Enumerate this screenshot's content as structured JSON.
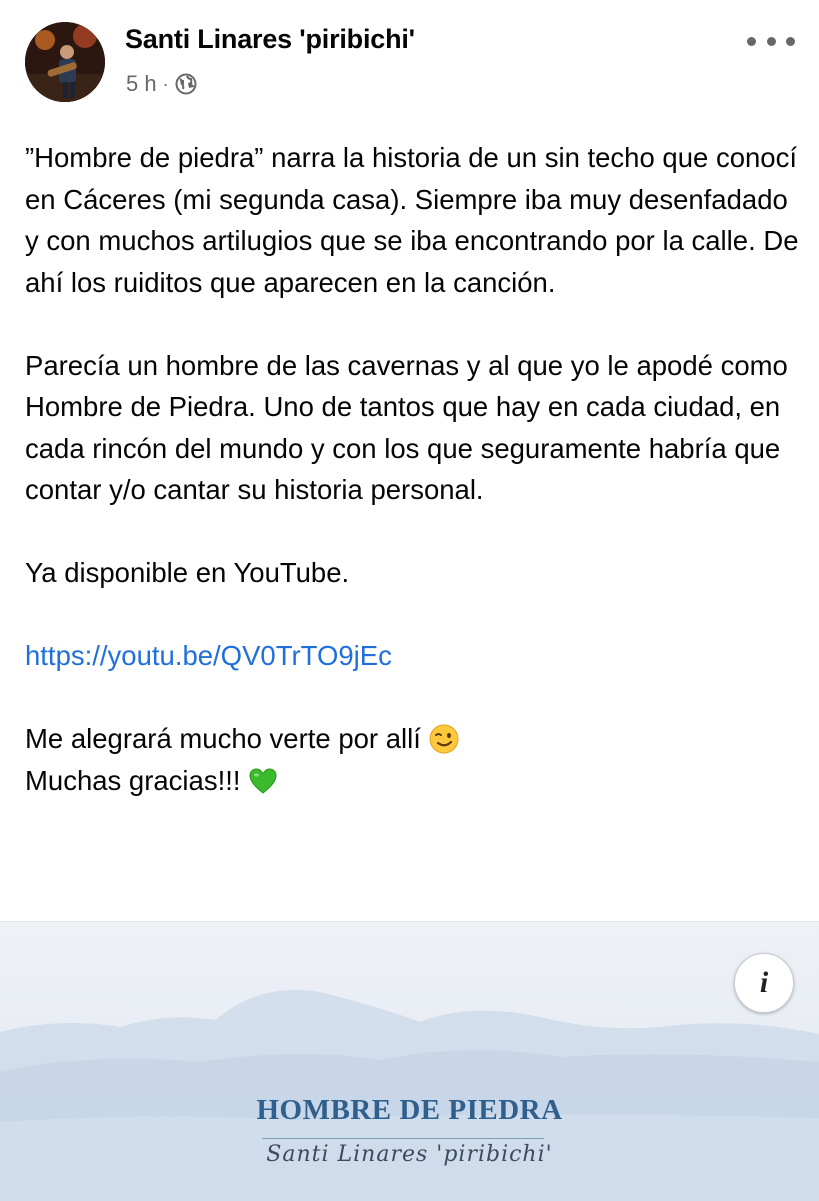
{
  "post": {
    "author": "Santi Linares 'piribichi'",
    "time": "5 h",
    "separator": "·",
    "privacy_icon": "globe-icon",
    "more_icon": "more-options-icon",
    "paragraphs": [
      "”Hombre de piedra” narra la historia de un sin techo que conocí en Cáceres (mi segunda casa). Siempre iba muy desenfadado y con muchos artilugios que se iba encontrando por la calle. De ahí los ruiditos que aparecen en la canción.",
      "Parecía un hombre de las cavernas y al que yo le apodé como Hombre de Piedra. Uno de tantos que hay en cada ciudad, en cada rincón del mundo y con los que seguramente habría que contar y/o cantar su historia personal.",
      "Ya disponible en YouTube."
    ],
    "link": "https://youtu.be/QV0TrTO9jEc",
    "closing_line_1": "Me alegrará mucho verte por allí",
    "closing_emoji_1": "winking-face-emoji",
    "closing_line_2": "Muchas gracias!!!",
    "closing_emoji_2": "green-heart-emoji"
  },
  "media": {
    "info_icon": "info-icon",
    "info_label": "i",
    "album_title": "HOMBRE DE PIEDRA",
    "album_artist": "Santi Linares 'piribichi'"
  },
  "colors": {
    "text": "#050505",
    "secondary": "#65676b",
    "link": "#216fdb",
    "album_title": "#2f5f8c"
  }
}
